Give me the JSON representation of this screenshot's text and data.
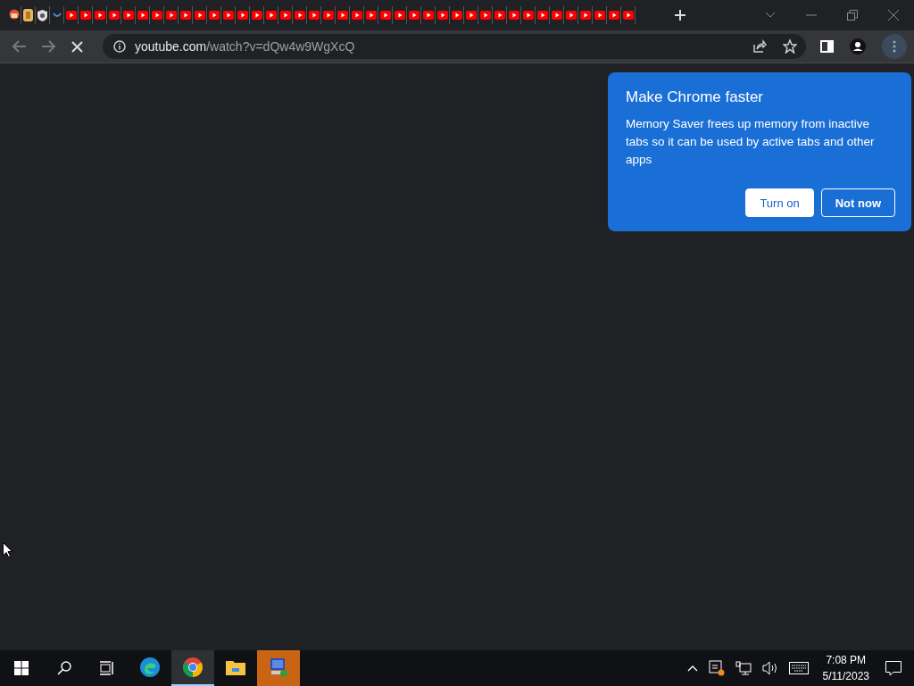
{
  "tabs": [
    {
      "kind": "avatar"
    },
    {
      "kind": "coin"
    },
    {
      "kind": "shield"
    },
    {
      "kind": "loading"
    },
    {
      "kind": "youtube"
    },
    {
      "kind": "youtube"
    },
    {
      "kind": "youtube"
    },
    {
      "kind": "youtube"
    },
    {
      "kind": "youtube"
    },
    {
      "kind": "youtube"
    },
    {
      "kind": "youtube"
    },
    {
      "kind": "youtube"
    },
    {
      "kind": "youtube"
    },
    {
      "kind": "youtube"
    },
    {
      "kind": "youtube"
    },
    {
      "kind": "youtube"
    },
    {
      "kind": "youtube"
    },
    {
      "kind": "youtube"
    },
    {
      "kind": "youtube"
    },
    {
      "kind": "youtube"
    },
    {
      "kind": "youtube"
    },
    {
      "kind": "youtube"
    },
    {
      "kind": "youtube"
    },
    {
      "kind": "youtube"
    },
    {
      "kind": "youtube"
    },
    {
      "kind": "youtube"
    },
    {
      "kind": "youtube"
    },
    {
      "kind": "youtube"
    },
    {
      "kind": "youtube"
    },
    {
      "kind": "youtube"
    },
    {
      "kind": "youtube"
    },
    {
      "kind": "youtube"
    },
    {
      "kind": "youtube"
    },
    {
      "kind": "youtube"
    },
    {
      "kind": "youtube"
    },
    {
      "kind": "youtube"
    },
    {
      "kind": "youtube"
    },
    {
      "kind": "youtube"
    },
    {
      "kind": "youtube"
    },
    {
      "kind": "youtube"
    },
    {
      "kind": "youtube"
    },
    {
      "kind": "youtube"
    },
    {
      "kind": "youtube"
    },
    {
      "kind": "youtube"
    }
  ],
  "address": {
    "host": "youtube.com",
    "path": "/watch?v=dQw4w9WgXcQ"
  },
  "popup": {
    "title": "Make Chrome faster",
    "body": "Memory Saver frees up memory from inactive tabs so it can be used by active tabs and other apps",
    "buttons": [
      {
        "label": "Turn on",
        "kind": "primary"
      },
      {
        "label": "Not now",
        "kind": "secondary"
      }
    ]
  },
  "taskbar": {
    "apps": [
      {
        "kind": "edge",
        "active": false,
        "highlighted": false
      },
      {
        "kind": "chrome",
        "active": true,
        "highlighted": false
      },
      {
        "kind": "explorer",
        "active": false,
        "highlighted": false
      },
      {
        "kind": "remote",
        "active": false,
        "highlighted": true
      }
    ],
    "time": "7:08 PM",
    "date": "5/11/2023"
  }
}
